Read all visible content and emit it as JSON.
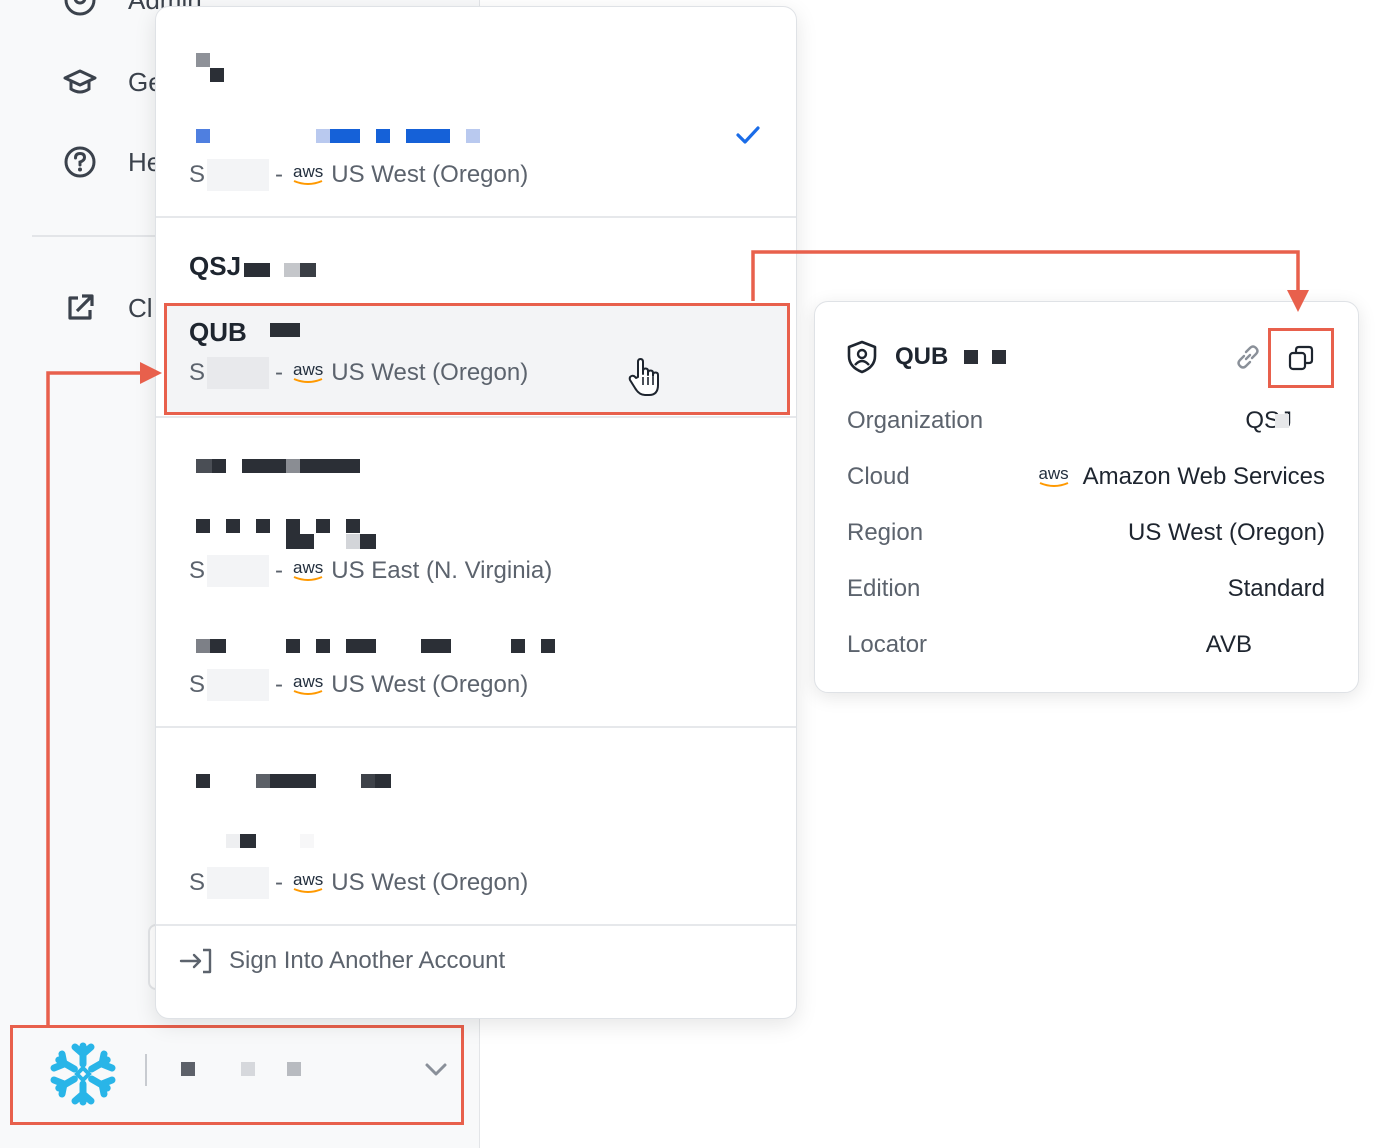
{
  "sidebar": {
    "items": [
      {
        "label": "Admin",
        "icon": "user-shield-icon"
      },
      {
        "label": "Ge",
        "icon": "graduation-cap-icon"
      },
      {
        "label": "He",
        "icon": "help-circle-icon"
      },
      {
        "label": "Cl",
        "icon": "external-link-icon"
      }
    ]
  },
  "account_bar": {
    "logo": "snowflake-logo",
    "chevron": "chevron-down-icon"
  },
  "dropdown": {
    "accounts": [
      {
        "title": "",
        "edition_prefix": "S",
        "cloud": "aws",
        "region": "US West (Oregon)",
        "selected": true
      },
      {
        "group_title": "QSJ",
        "title": "QUB",
        "edition_prefix": "S",
        "cloud": "aws",
        "region": "US West (Oregon)",
        "hovered": true
      },
      {
        "title": "",
        "edition_prefix": "S",
        "cloud": "aws",
        "region": "US East (N. Virginia)"
      },
      {
        "title": "",
        "edition_prefix": "S",
        "cloud": "aws",
        "region": "US West (Oregon)"
      },
      {
        "title": "",
        "edition_prefix": "S",
        "cloud": "aws",
        "region": "US West (Oregon)"
      }
    ],
    "separator": "-",
    "sign_in_label": "Sign Into Another Account",
    "sign_in_icon": "sign-in-icon"
  },
  "details": {
    "name": "QUB",
    "icon": "account-shield-icon",
    "link_icon": "link-icon",
    "copy_icon": "copy-icon",
    "rows": [
      {
        "label": "Organization",
        "value": "QSJ"
      },
      {
        "label": "Cloud",
        "value": "Amazon Web Services",
        "logo": "aws"
      },
      {
        "label": "Region",
        "value": "US West (Oregon)"
      },
      {
        "label": "Edition",
        "value": "Standard"
      },
      {
        "label": "Locator",
        "value": "AVB"
      }
    ]
  },
  "colors": {
    "annotation": "#e8604c",
    "check": "#1a6ce8",
    "snowflake": "#29b5e8",
    "aws_orange": "#ff9900"
  }
}
